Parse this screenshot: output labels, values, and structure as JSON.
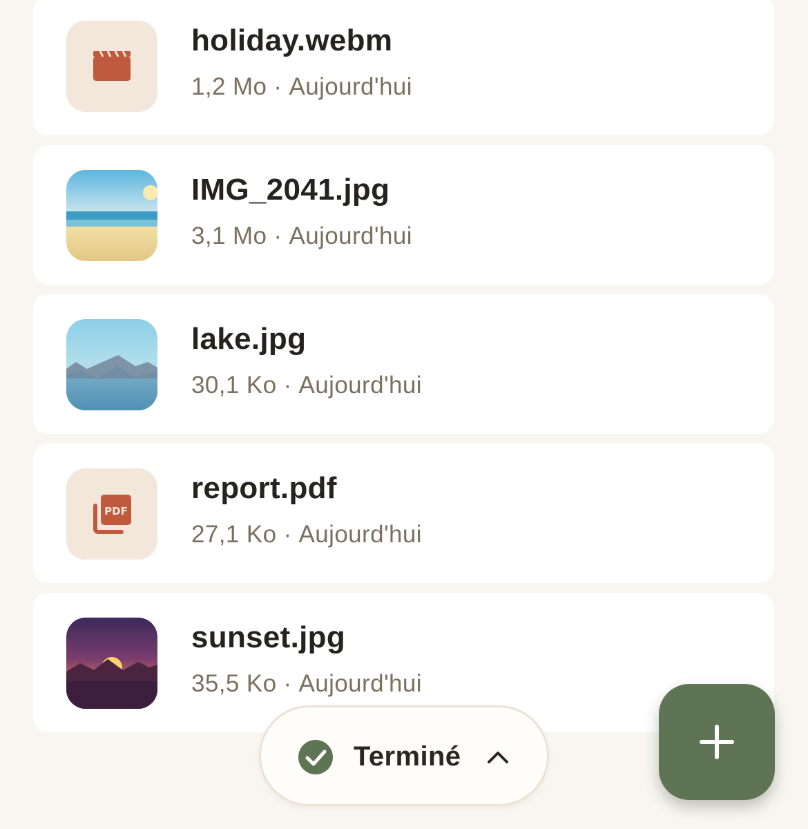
{
  "files": [
    {
      "name": "holiday.webm",
      "size": "1,2 Mo",
      "separator": "·",
      "date": "Aujourd'hui",
      "icon": "video-clapper-icon"
    },
    {
      "name": "IMG_2041.jpg",
      "size": "3,1 Mo",
      "separator": "·",
      "date": "Aujourd'hui",
      "icon": "beach-thumbnail"
    },
    {
      "name": "lake.jpg",
      "size": "30,1 Ko",
      "separator": "·",
      "date": "Aujourd'hui",
      "icon": "lake-thumbnail"
    },
    {
      "name": "report.pdf",
      "size": "27,1 Ko",
      "separator": "·",
      "date": "Aujourd'hui",
      "icon": "pdf-icon",
      "icon_text": "PDF"
    },
    {
      "name": "sunset.jpg",
      "size": "35,5 Ko",
      "separator": "·",
      "date": "Aujourd'hui",
      "icon": "sunset-thumbnail"
    }
  ],
  "upload_status": {
    "label": "Terminé",
    "icon": "check-circle-icon",
    "toggle_icon": "chevron-up-icon"
  },
  "fab": {
    "icon": "plus-icon"
  },
  "colors": {
    "background": "#f9f6f1",
    "card": "#ffffff",
    "accent": "#5f7455",
    "file_icon": "#bf5a3e",
    "icon_tile": "#f3e6db",
    "meta_text": "#7b705f"
  }
}
